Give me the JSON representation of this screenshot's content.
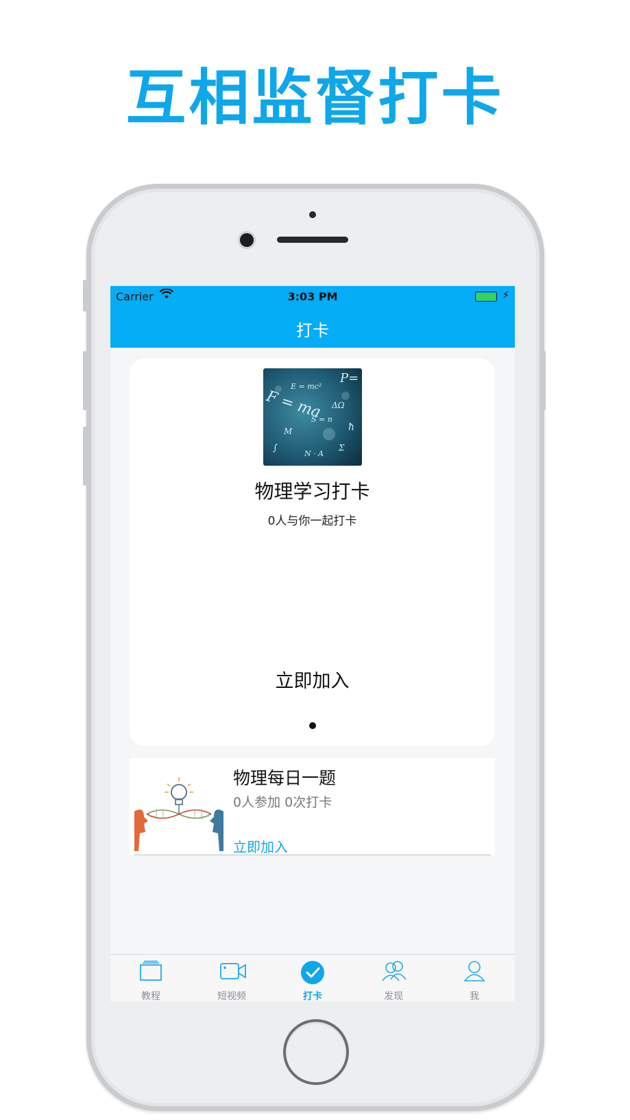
{
  "promo": {
    "headline": "互相监督打卡"
  },
  "status_bar": {
    "carrier": "Carrier",
    "time": "3:03 PM"
  },
  "nav": {
    "title": "打卡"
  },
  "featured": {
    "title": "物理学习打卡",
    "subtitle": "0人与你一起打卡",
    "join_label": "立即加入",
    "image_formulas": [
      "P=",
      "F = ma",
      "E = mc²",
      "ΔΩ",
      "ħ",
      "M",
      "S = n",
      "N · A",
      "∫",
      "Σ"
    ]
  },
  "list": [
    {
      "title": "物理每日一题",
      "meta": "0人参加 0次打卡",
      "join_label": "立即加入"
    }
  ],
  "tabs": [
    {
      "label": "教程",
      "icon": "book-icon",
      "active": false
    },
    {
      "label": "短视频",
      "icon": "video-camera-icon",
      "active": false
    },
    {
      "label": "打卡",
      "icon": "checkmark-circle-icon",
      "active": true
    },
    {
      "label": "发现",
      "icon": "people-icon",
      "active": false
    },
    {
      "label": "我",
      "icon": "person-icon",
      "active": false
    }
  ],
  "colors": {
    "accent": "#04adf5",
    "headline": "#0ea7e9",
    "battery": "#39d353"
  }
}
